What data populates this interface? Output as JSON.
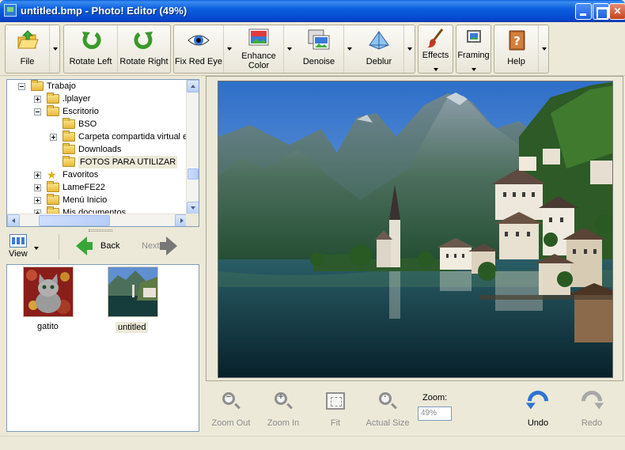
{
  "window": {
    "title": "untitled.bmp - Photo! Editor (49%)"
  },
  "toolbar": {
    "file": "File",
    "rotate_left": "Rotate Left",
    "rotate_right": "Rotate Right",
    "fix_red_eye": "Fix Red Eye",
    "enhance_color_line1": "Enhance",
    "enhance_color_line2": "Color",
    "denoise": "Denoise",
    "deblur": "Deblur",
    "effects": "Effects",
    "framing": "Framing",
    "help": "Help"
  },
  "tree": {
    "items": [
      {
        "label": "Trabajo",
        "level": 1,
        "expander": "minus"
      },
      {
        "label": ".lplayer",
        "level": 2,
        "expander": "plus"
      },
      {
        "label": "Escritorio",
        "level": 2,
        "expander": "minus"
      },
      {
        "label": "BSO",
        "level": 3,
        "expander": "none"
      },
      {
        "label": "Carpeta compartida virtual e",
        "level": 3,
        "expander": "plus"
      },
      {
        "label": "Downloads",
        "level": 3,
        "expander": "none"
      },
      {
        "label": "FOTOS PARA UTILIZAR",
        "level": 3,
        "expander": "none",
        "selected": true
      },
      {
        "label": "Favoritos",
        "level": 2,
        "expander": "plus",
        "icon": "star-icon"
      },
      {
        "label": "LameFE22",
        "level": 2,
        "expander": "plus"
      },
      {
        "label": "Menú Inicio",
        "level": 2,
        "expander": "plus"
      },
      {
        "label": "Mis documentos",
        "level": 2,
        "expander": "plus"
      }
    ]
  },
  "nav": {
    "view": "View",
    "back": "Back",
    "next": "Next"
  },
  "thumbnails": [
    {
      "caption": "gatito",
      "selected": false
    },
    {
      "caption": "untitled",
      "selected": true
    }
  ],
  "bottom": {
    "zoom_out": "Zoom Out",
    "zoom_in": "Zoom In",
    "fit": "Fit",
    "actual_size": "Actual Size",
    "zoom_label": "Zoom:",
    "zoom_value": "49%",
    "undo": "Undo",
    "redo": "Redo"
  }
}
